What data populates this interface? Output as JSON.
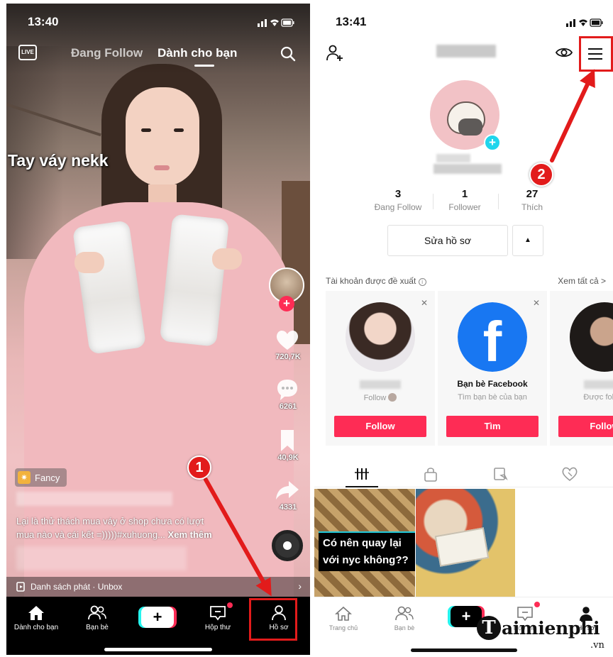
{
  "left_phone": {
    "status_time": "13:40",
    "live_label": "LIVE",
    "tabs": {
      "following": "Đang Follow",
      "for_you": "Dành cho bạn"
    },
    "video_caption": "Tay váy nekk",
    "side_counts": {
      "likes": "720,7K",
      "comments": "6261",
      "saves": "40,9K",
      "shares": "4331"
    },
    "effect_label": "Fancy",
    "description_line1": "Lại là thử thách mua váy ở shop chưa có lượt",
    "description_line2": "mua nào và cái kết =)))))#xuhuong...",
    "description_more": "Xem thêm",
    "playlist": "Danh sách phát · Unbox",
    "nav": {
      "home": "Dành cho bạn",
      "friends": "Bạn bè",
      "create": "+",
      "inbox": "Hộp thư",
      "profile": "Hồ sơ"
    }
  },
  "right_phone": {
    "status_time": "13:41",
    "stats": [
      {
        "value": "3",
        "label": "Đang Follow"
      },
      {
        "value": "1",
        "label": "Follower"
      },
      {
        "value": "27",
        "label": "Thích"
      }
    ],
    "edit_profile": "Sửa hồ sơ",
    "caret": "▲",
    "suggested_title": "Tài khoản được đề xuất",
    "see_all": "Xem tất cả >",
    "cards": [
      {
        "name": "",
        "sub": "Follow",
        "button": "Follow"
      },
      {
        "name": "Bạn bè Facebook",
        "sub": "Tìm bạn bè của bạn",
        "button": "Tìm"
      },
      {
        "name": "",
        "sub": "Được follow",
        "button": "Follow"
      }
    ],
    "video_caption": "Có nên quay lại với nyc không??",
    "nav": {
      "home": "Trang chủ",
      "friends": "Bạn bè",
      "create": "+",
      "inbox": "Hộp thư",
      "profile": "Hồ sơ"
    }
  },
  "callouts": {
    "step1": "1",
    "step2": "2"
  },
  "watermark": {
    "letter": "T",
    "text": "aimienphi",
    "suffix": ".vn"
  },
  "colors": {
    "tiktok_red": "#fe2c55",
    "tiktok_cyan": "#25f4ee",
    "callout_red": "#e21b1b",
    "facebook_blue": "#1877f2"
  }
}
